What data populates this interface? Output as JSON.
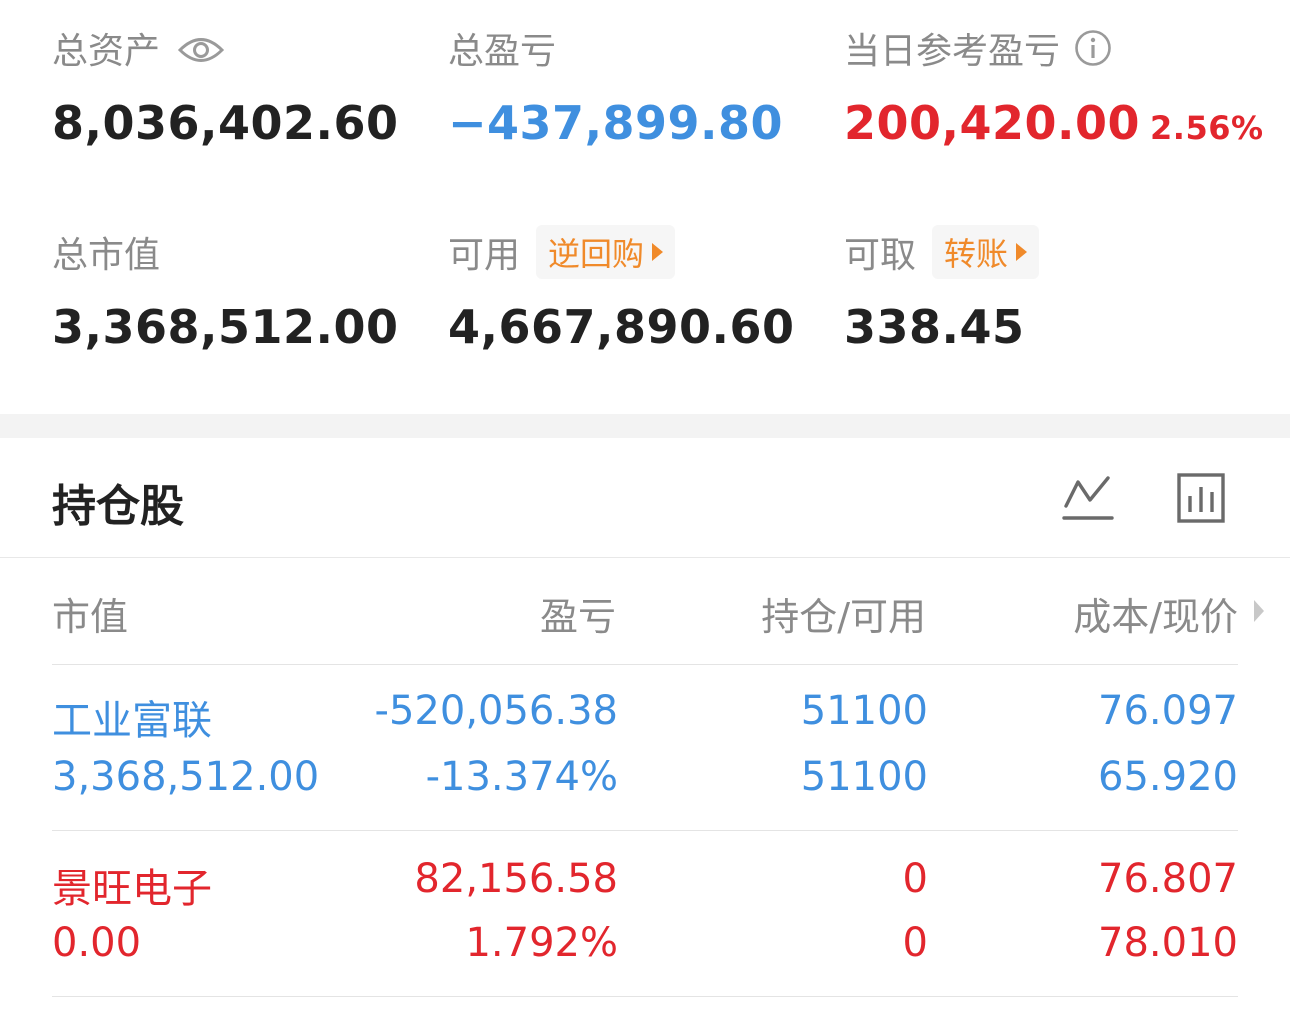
{
  "summary": {
    "total_assets_label": "总资产",
    "total_assets_value": "8,036,402.60",
    "total_pl_label": "总盈亏",
    "total_pl_value": "−437,899.80",
    "daily_pl_label": "当日参考盈亏",
    "daily_pl_value": "200,420.00",
    "daily_pl_pct": "2.56%",
    "market_value_label": "总市值",
    "market_value_value": "3,368,512.00",
    "available_label": "可用",
    "available_tag": "逆回购",
    "available_value": "4,667,890.60",
    "withdrawable_label": "可取",
    "withdrawable_tag": "转账",
    "withdrawable_value": "338.45"
  },
  "holdings": {
    "title": "持仓股",
    "columns": [
      "市值",
      "盈亏",
      "持仓/可用",
      "成本/现价"
    ],
    "rows": [
      {
        "name": "工业富联",
        "market_value": "3,368,512.00",
        "pl": "-520,056.38",
        "pl_pct": "-13.374%",
        "position": "51100",
        "available": "51100",
        "cost": "76.097",
        "price": "65.920",
        "color": "#3f8fdf"
      },
      {
        "name": "景旺电子",
        "market_value": "0.00",
        "pl": "82,156.58",
        "pl_pct": "1.792%",
        "position": "0",
        "available": "0",
        "cost": "76.807",
        "price": "78.010",
        "color": "#e2262d"
      }
    ]
  },
  "icons": {
    "eye": "eye-icon",
    "info": "info-icon",
    "line_chart": "line-chart-icon",
    "bar_chart": "bar-chart-icon"
  },
  "colors": {
    "loss_blue": "#3f8fdf",
    "gain_red": "#e2262d",
    "tag_orange": "#f08a2a"
  }
}
